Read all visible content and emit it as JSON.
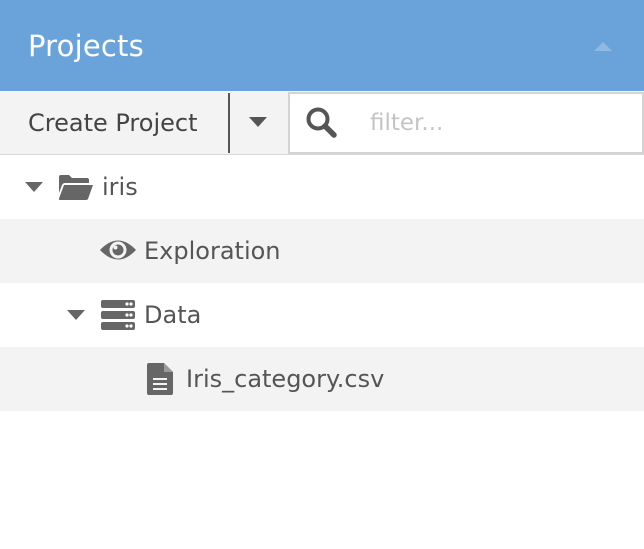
{
  "header": {
    "title": "Projects",
    "collapse_icon": "caret-up-icon",
    "background": "#6aa3d9"
  },
  "toolbar": {
    "create_label": "Create Project",
    "dropdown_icon": "caret-down-icon"
  },
  "filter": {
    "icon": "search-icon",
    "placeholder": "filter...",
    "value": ""
  },
  "tree": [
    {
      "label": "iris",
      "icon": "folder-open-icon",
      "expanded": true,
      "level": 0
    },
    {
      "label": "Exploration",
      "icon": "eye-icon",
      "level": 1
    },
    {
      "label": "Data",
      "icon": "server-icon",
      "expanded": true,
      "level": 1
    },
    {
      "label": "Iris_category.csv",
      "icon": "file-text-icon",
      "level": 2
    }
  ]
}
